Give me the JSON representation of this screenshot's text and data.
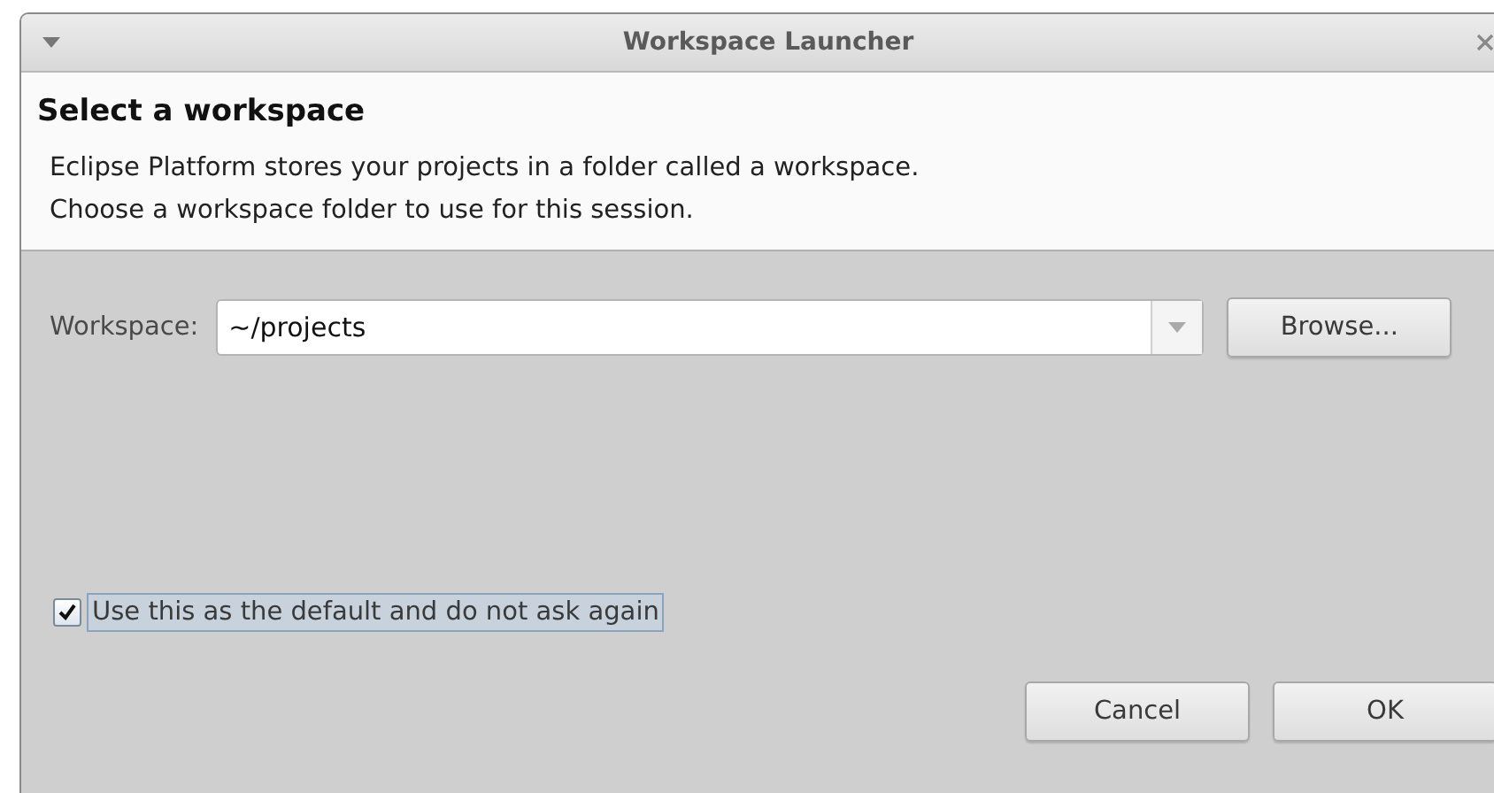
{
  "window": {
    "title": "Workspace Launcher"
  },
  "header": {
    "title": "Select a workspace",
    "description": [
      "Eclipse Platform stores your projects in a folder called a workspace.",
      "Choose a workspace folder to use for this session."
    ]
  },
  "workspace": {
    "label": "Workspace:",
    "value": "~/projects",
    "browse": "Browse..."
  },
  "default_checkbox": {
    "label": "Use this as the default and do not ask again",
    "checked": true,
    "focused": true
  },
  "buttons": [
    {
      "label": "Cancel"
    },
    {
      "label": "OK"
    }
  ]
}
